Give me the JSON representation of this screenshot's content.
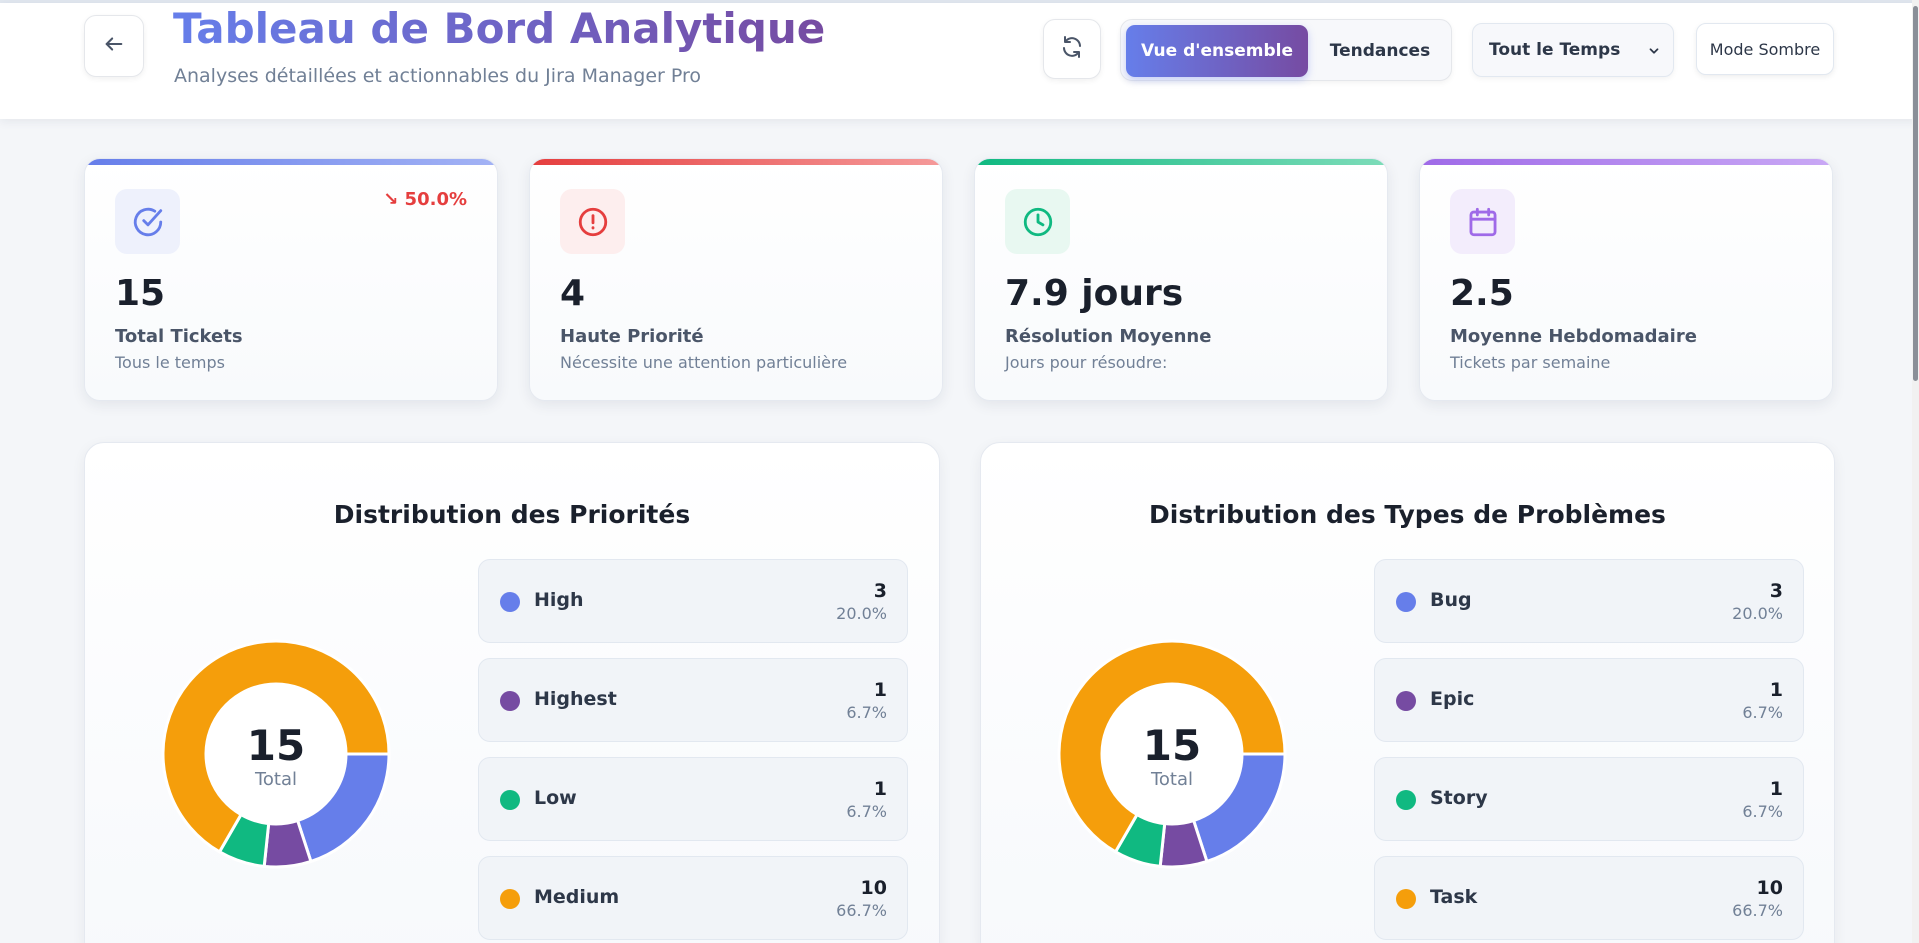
{
  "header": {
    "title": "Tableau de Bord Analytique",
    "subtitle": "Analyses détaillées et actionnables du Jira Manager Pro",
    "back_icon": "arrow-left-icon",
    "refresh_icon": "refresh-icon",
    "tabs": [
      {
        "label": "Vue d'ensemble",
        "active": true
      },
      {
        "label": "Tendances",
        "active": false
      }
    ],
    "time_filter": {
      "selected": "Tout le Temps"
    },
    "mode_button": "Mode Sombre"
  },
  "colors": {
    "accent_start": "#667eea",
    "accent_end": "#764ba2",
    "blue": "#667eea",
    "purple": "#764ba2",
    "green": "#10b981",
    "orange": "#f59e0b",
    "red": "#e53e3e",
    "violet": "#9f6ae8"
  },
  "stats": [
    {
      "icon": "check-circle-icon",
      "value": "15",
      "label": "Total Tickets",
      "desc": "Tous le temps",
      "trend": "↘ 50.0%",
      "accent": "#667eea"
    },
    {
      "icon": "alert-circle-icon",
      "value": "4",
      "label": "Haute Priorité",
      "desc": "Nécessite une attention particulière",
      "trend": "",
      "accent": "#e53e3e"
    },
    {
      "icon": "clock-icon",
      "value": "7.9 jours",
      "label": "Résolution Moyenne",
      "desc": "Jours pour résoudre:",
      "trend": "",
      "accent": "#10b981"
    },
    {
      "icon": "calendar-icon",
      "value": "2.5",
      "label": "Moyenne Hebdomadaire",
      "desc": "Tickets par semaine",
      "trend": "",
      "accent": "#9f6ae8"
    }
  ],
  "panels": [
    {
      "title": "Distribution des Priorités",
      "total_value": "15",
      "total_label": "Total",
      "items": [
        {
          "name": "High",
          "count": "3",
          "pct": "20.0%",
          "value": 3,
          "color": "#667eea"
        },
        {
          "name": "Highest",
          "count": "1",
          "pct": "6.7%",
          "value": 1,
          "color": "#764ba2"
        },
        {
          "name": "Low",
          "count": "1",
          "pct": "6.7%",
          "value": 1,
          "color": "#10b981"
        },
        {
          "name": "Medium",
          "count": "10",
          "pct": "66.7%",
          "value": 10,
          "color": "#f59e0b"
        }
      ]
    },
    {
      "title": "Distribution des Types de Problèmes",
      "total_value": "15",
      "total_label": "Total",
      "items": [
        {
          "name": "Bug",
          "count": "3",
          "pct": "20.0%",
          "value": 3,
          "color": "#667eea"
        },
        {
          "name": "Epic",
          "count": "1",
          "pct": "6.7%",
          "value": 1,
          "color": "#764ba2"
        },
        {
          "name": "Story",
          "count": "1",
          "pct": "6.7%",
          "value": 1,
          "color": "#10b981"
        },
        {
          "name": "Task",
          "count": "10",
          "pct": "66.7%",
          "value": 10,
          "color": "#f59e0b"
        }
      ]
    }
  ]
}
